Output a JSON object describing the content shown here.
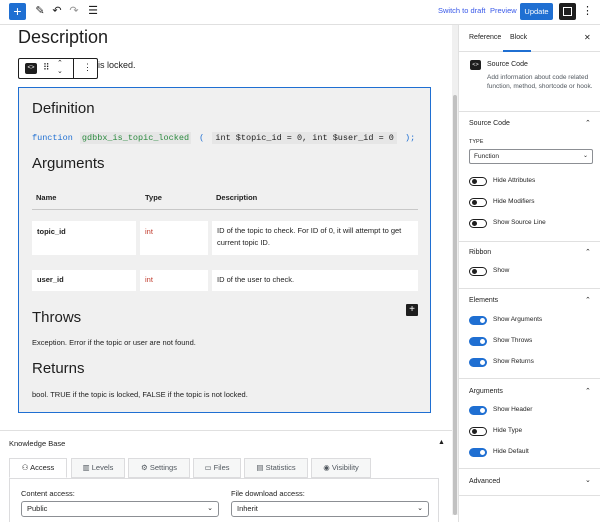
{
  "toolbar": {
    "add_label": "+",
    "switch_to_draft": "Switch to draft",
    "preview": "Preview",
    "update": "Update"
  },
  "editor": {
    "heading": "Description",
    "locked_text": "is locked.",
    "definition_heading": "Definition",
    "function": {
      "keyword": "function",
      "name": "gdbbx_is_topic_locked",
      "open_paren": "(",
      "args": "int $topic_id = 0, int $user_id = 0",
      "close": ");"
    },
    "arguments_heading": "Arguments",
    "table": {
      "headers": [
        "Name",
        "Type",
        "Description"
      ],
      "rows": [
        {
          "name": "topic_id",
          "type": "int",
          "description": "ID of the topic to check. For ID of 0, it will attempt to get current topic ID."
        },
        {
          "name": "user_id",
          "type": "int",
          "description": "ID of the user to check."
        }
      ]
    },
    "throws_heading": "Throws",
    "throws_text": "Exception. Error if the topic or user are not found.",
    "returns_heading": "Returns",
    "returns_text": "bool. TRUE if the topic is locked, FALSE if the topic is not locked."
  },
  "knowledge_base": {
    "title": "Knowledge Base",
    "tabs": [
      {
        "icon": "users-icon",
        "label": "Access",
        "active": true
      },
      {
        "icon": "chart-bars-icon",
        "label": "Levels",
        "active": false
      },
      {
        "icon": "settings-icon",
        "label": "Settings",
        "active": false
      },
      {
        "icon": "folder-icon",
        "label": "Files",
        "active": false
      },
      {
        "icon": "statistics-icon",
        "label": "Statistics",
        "active": false
      },
      {
        "icon": "eye-icon",
        "label": "Visibility",
        "active": false
      }
    ],
    "content_access_label": "Content access:",
    "content_access_value": "Public",
    "file_download_label": "File download access:",
    "file_download_value": "Inherit"
  },
  "sidebar": {
    "tab_reference": "Reference",
    "tab_block": "Block",
    "block_title": "Source Code",
    "block_description": "Add information about code related function, method, shortcode or hook.",
    "source_code_heading": "Source Code",
    "type_label": "TYPE",
    "type_value": "Function",
    "source_toggles": [
      {
        "label": "Hide Attributes",
        "on": false
      },
      {
        "label": "Hide Modifiers",
        "on": false
      },
      {
        "label": "Show Source Line",
        "on": false
      }
    ],
    "ribbon_heading": "Ribbon",
    "ribbon_toggles": [
      {
        "label": "Show",
        "on": false
      }
    ],
    "elements_heading": "Elements",
    "elements_toggles": [
      {
        "label": "Show Arguments",
        "on": true
      },
      {
        "label": "Show Throws",
        "on": true
      },
      {
        "label": "Show Returns",
        "on": true
      }
    ],
    "arguments_heading": "Arguments",
    "arguments_toggles": [
      {
        "label": "Show Header",
        "on": true
      },
      {
        "label": "Hide Type",
        "on": false
      },
      {
        "label": "Hide Default",
        "on": true
      }
    ],
    "advanced_heading": "Advanced"
  },
  "colors": {
    "accent": "#1f6fd2",
    "type_red": "#c0392b",
    "function_green": "#2b8a3e"
  }
}
